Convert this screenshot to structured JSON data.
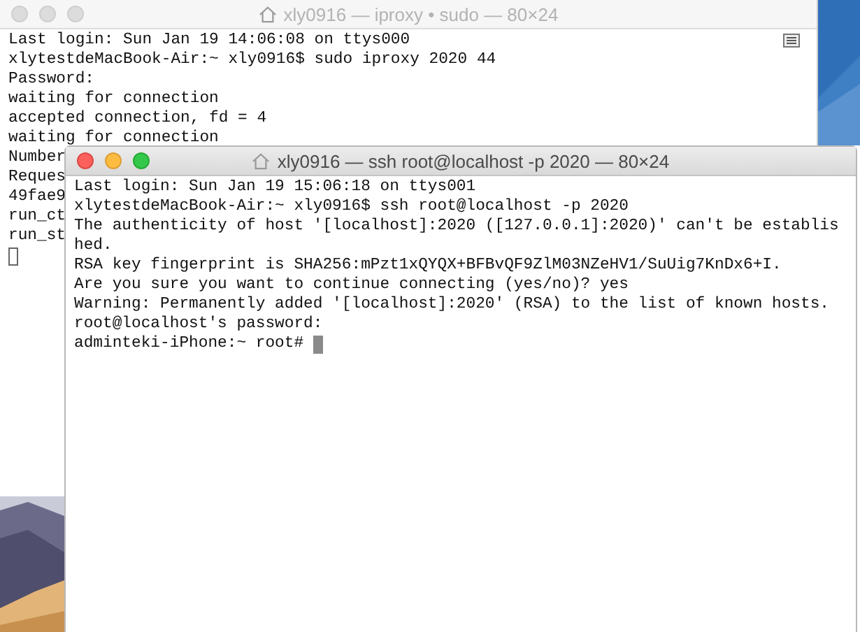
{
  "windows": [
    {
      "title": "xly0916 — iproxy • sudo — 80×24",
      "active": false,
      "cursor_own_line": true,
      "lines": [
        "Last login: Sun Jan 19 14:06:08 on ttys000",
        "xlytestdeMacBook-Air:~ xly0916$ sudo iproxy 2020 44",
        "Password:",
        "waiting for connection",
        "accepted connection, fd = 4",
        "waiting for connection",
        "Number",
        "Reques",
        "49fae9",
        "run_ct",
        "run_st"
      ]
    },
    {
      "title": "xly0916 — ssh root@localhost -p 2020 — 80×24",
      "active": true,
      "cursor_own_line": false,
      "lines": [
        "Last login: Sun Jan 19 15:06:18 on ttys001",
        "xlytestdeMacBook-Air:~ xly0916$ ssh root@localhost -p 2020",
        "The authenticity of host '[localhost]:2020 ([127.0.0.1]:2020)' can't be establis",
        "hed.",
        "RSA key fingerprint is SHA256:mPzt1xQYQX+BFBvQF9ZlM03NZeHV1/SuUig7KnDx6+I.",
        "Are you sure you want to continue connecting (yes/no)? yes",
        "Warning: Permanently added '[localhost]:2020' (RSA) to the list of known hosts.",
        "root@localhost's password:",
        "adminteki-iPhone:~ root# "
      ]
    }
  ]
}
